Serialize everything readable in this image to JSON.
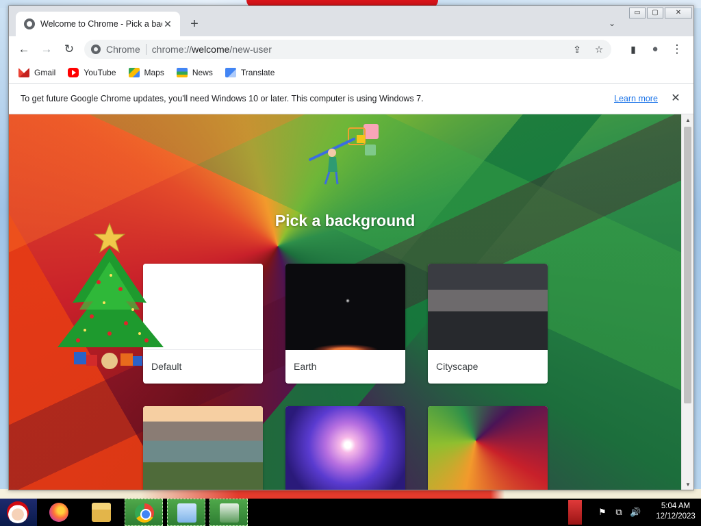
{
  "window": {
    "tab_title": "Welcome to Chrome - Pick a bac",
    "new_tab_symbol": "+",
    "tab_close_symbol": "✕",
    "tab_search_symbol": "⌄",
    "controls": {
      "minimize": "▭",
      "maximize": "▢",
      "close": "✕"
    }
  },
  "toolbar": {
    "back": "←",
    "forward": "→",
    "reload": "↻",
    "site_chip": "Chrome",
    "url_scheme": "chrome://",
    "url_host": "welcome",
    "url_path": "/new-user",
    "share": "⇪",
    "star": "☆",
    "side_panel": "▮",
    "profile": "●",
    "menu": "⋮"
  },
  "bookmarks": [
    {
      "label": "Gmail",
      "icon": "gmail-icon"
    },
    {
      "label": "YouTube",
      "icon": "youtube-icon"
    },
    {
      "label": "Maps",
      "icon": "maps-icon"
    },
    {
      "label": "News",
      "icon": "news-icon"
    },
    {
      "label": "Translate",
      "icon": "translate-icon"
    }
  ],
  "infobar": {
    "message": "To get future Google Chrome updates, you'll need Windows 10 or later. This computer is using Windows 7.",
    "link": "Learn more",
    "close": "✕"
  },
  "page": {
    "heading": "Pick a background",
    "cards": [
      {
        "label": "Default"
      },
      {
        "label": "Earth"
      },
      {
        "label": "Cityscape"
      },
      {
        "label": ""
      },
      {
        "label": ""
      },
      {
        "label": ""
      }
    ]
  },
  "scrollbar": {
    "up": "▲",
    "down": "▼"
  },
  "taskbar": {
    "apps": [
      "firefox-icon",
      "file-explorer-icon",
      "chrome-icon",
      "remote-desktop-icon",
      "task-manager-icon"
    ],
    "tray": {
      "flag": "⚑",
      "network": "⧉",
      "volume": "🔊"
    },
    "time": "5:04 AM",
    "date": "12/12/2023"
  },
  "colors": {
    "link": "#1a73e8",
    "tab_strip": "#dee1e6",
    "omnibox": "#f1f3f4"
  }
}
